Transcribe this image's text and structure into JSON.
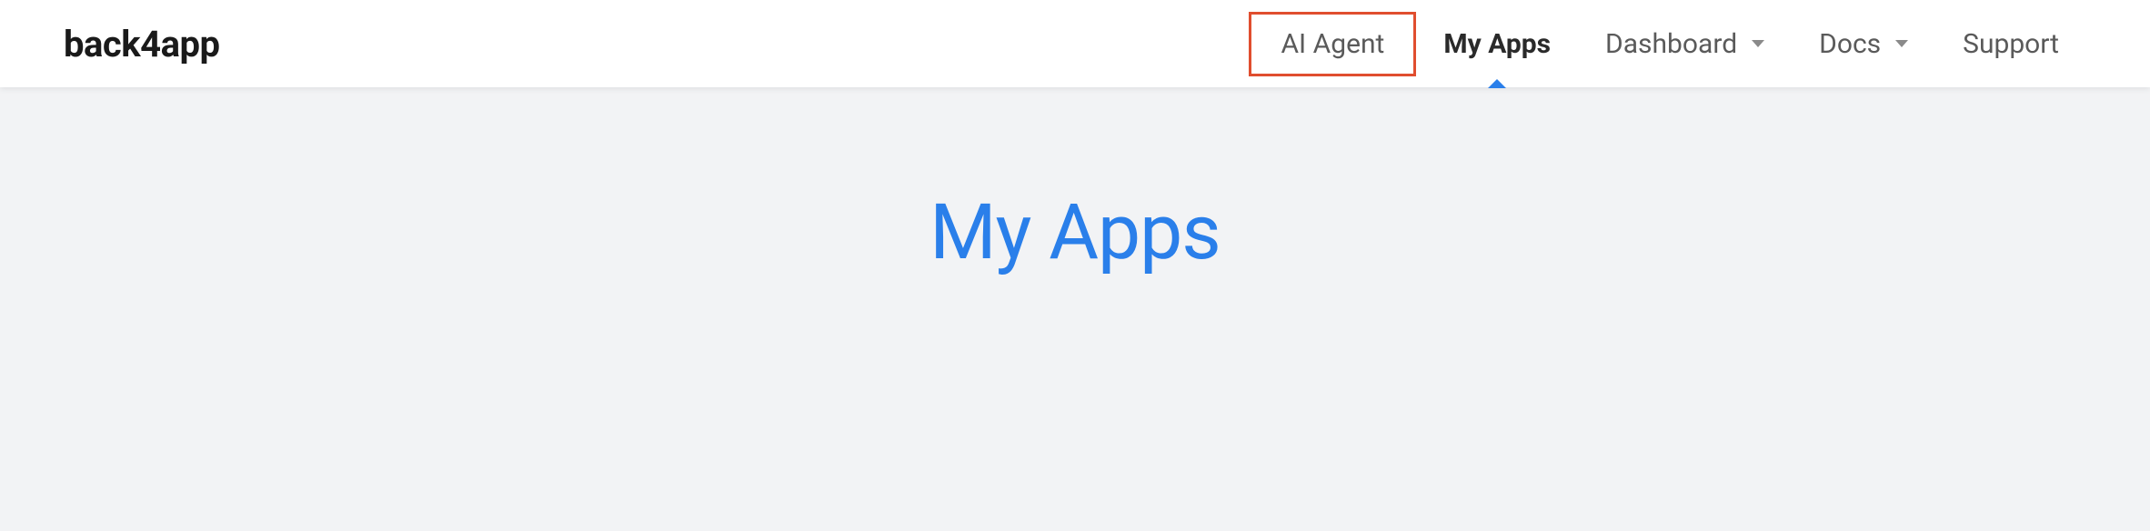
{
  "logo": "back4app",
  "nav": {
    "ai_agent": "AI Agent",
    "my_apps": "My Apps",
    "dashboard": "Dashboard",
    "docs": "Docs",
    "support": "Support"
  },
  "page": {
    "title": "My Apps"
  },
  "colors": {
    "accent": "#2a7fea",
    "highlight_border": "#e04e2f"
  }
}
